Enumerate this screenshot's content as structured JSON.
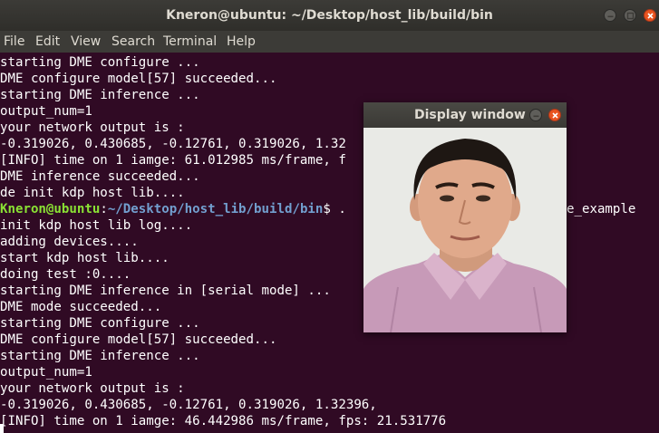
{
  "window": {
    "title": "Kneron@ubuntu: ~/Desktop/host_lib/build/bin"
  },
  "menu": [
    "File",
    "Edit",
    "View",
    "Search",
    "Terminal",
    "Help"
  ],
  "terminal": {
    "lines_before_prompt": [
      "starting DME configure ...",
      "DME configure model[57] succeeded...",
      "starting DME inference ...",
      "output_num=1",
      "your network output is :",
      "-0.319026, 0.430685, -0.12761, 0.319026, 1.32",
      "[INFO] time on 1 iamge: 61.012985 ms/frame, f",
      "DME inference succeeded...",
      "de init kdp host lib...."
    ],
    "prompt": {
      "user": "Kneron@ubuntu",
      "sep": ":",
      "path": "~/Desktop/host_lib/build/bin",
      "sign": "$ .",
      "command_tail": "e_example"
    },
    "lines_after_prompt": [
      "init kdp host lib log....",
      "adding devices....",
      "start kdp host lib....",
      "doing test :0....",
      "starting DME inference in [serial mode] ...",
      "DME mode succeeded...",
      "starting DME configure ...",
      "DME configure model[57] succeeded...",
      "starting DME inference ...",
      "output_num=1",
      "your network output is :",
      "-0.319026, 0.430685, -0.12761, 0.319026, 1.32396,",
      "[INFO] time on 1 iamge: 46.442986 ms/frame, fps: 21.531776"
    ]
  },
  "display_window": {
    "title": "Display window"
  },
  "colors": {
    "terminal_bg": "#300a24",
    "prompt_user": "#8ae234",
    "prompt_path": "#729fcf",
    "close_button": "#e95420"
  }
}
